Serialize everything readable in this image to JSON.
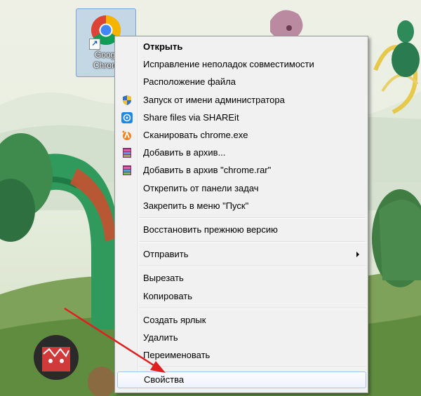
{
  "desktop": {
    "icon_label_line1": "Googl",
    "icon_label_line2": "Chrom"
  },
  "context_menu": {
    "items": [
      {
        "label": "Открыть",
        "icon": "none",
        "bold": true
      },
      {
        "label": "Исправление неполадок совместимости",
        "icon": "none"
      },
      {
        "label": "Расположение файла",
        "icon": "none"
      },
      {
        "label": "Запуск от имени администратора",
        "icon": "uac-shield-icon"
      },
      {
        "label": "Share files via SHAREit",
        "icon": "shareit-icon"
      },
      {
        "label": "Сканировать chrome.exe",
        "icon": "avast-icon"
      },
      {
        "label": "Добавить в архив...",
        "icon": "winrar-icon"
      },
      {
        "label": "Добавить в архив \"chrome.rar\"",
        "icon": "winrar-icon"
      },
      {
        "label": "Открепить от панели задач",
        "icon": "none"
      },
      {
        "label": "Закрепить в меню \"Пуск\"",
        "icon": "none"
      },
      {
        "label": "Восстановить прежнюю версию",
        "icon": "none"
      },
      {
        "label": "Отправить",
        "icon": "none",
        "submenu": true
      },
      {
        "label": "Вырезать",
        "icon": "none"
      },
      {
        "label": "Копировать",
        "icon": "none"
      },
      {
        "label": "Создать ярлык",
        "icon": "none"
      },
      {
        "label": "Удалить",
        "icon": "none"
      },
      {
        "label": "Переименовать",
        "icon": "none"
      },
      {
        "label": "Свойства",
        "icon": "none",
        "highlighted": true
      }
    ]
  },
  "colors": {
    "menu_bg": "#f1f1f1",
    "highlight_border": "#a8c3e6",
    "annotation_arrow": "#e02020"
  }
}
